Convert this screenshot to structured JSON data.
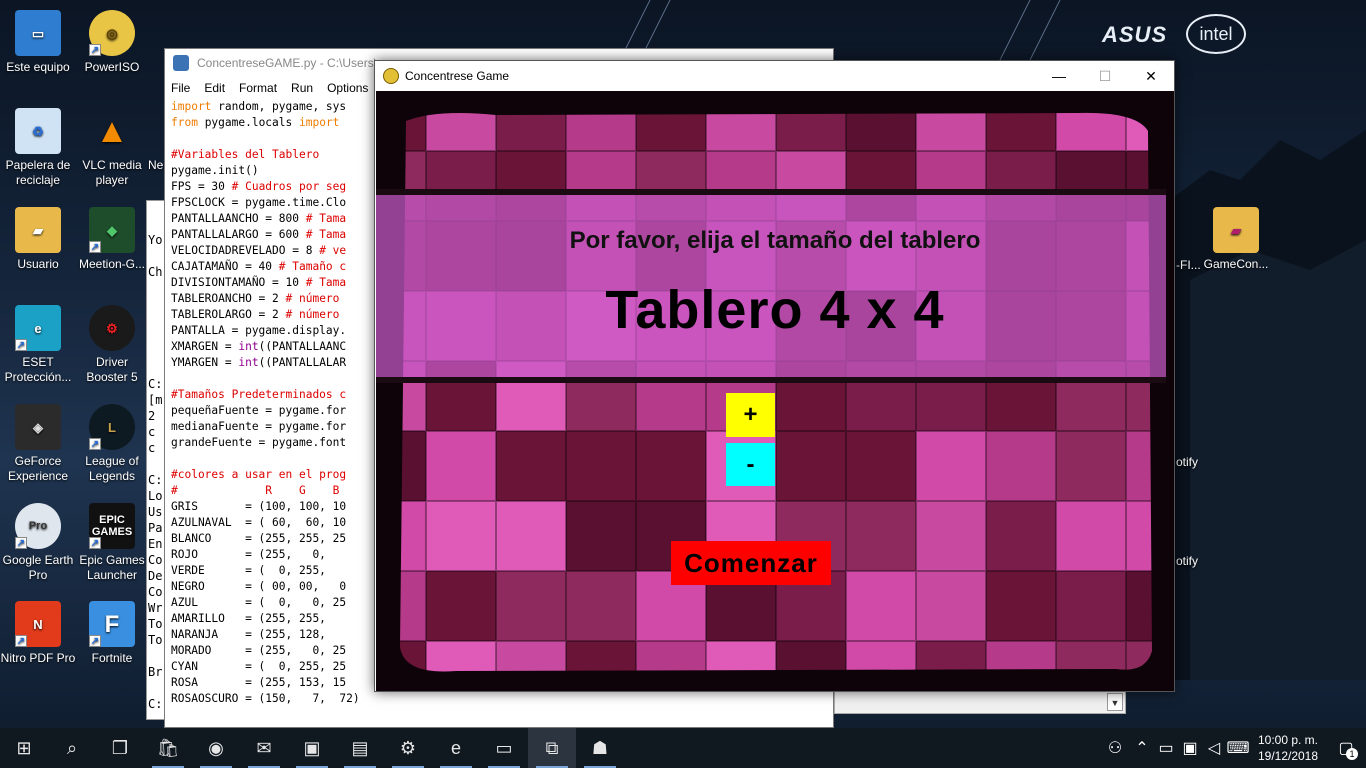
{
  "desktop": {
    "brand_asus": "ASUS",
    "brand_intel": "intel",
    "icons": [
      {
        "label": "Este equipo"
      },
      {
        "label": "PowerISO"
      },
      {
        "label": "Papelera de reciclaje"
      },
      {
        "label": "VLC media player"
      },
      {
        "label": "Usuario"
      },
      {
        "label": "Meetion-G..."
      },
      {
        "label": "ESET Protección..."
      },
      {
        "label": "Driver Booster 5"
      },
      {
        "label": "GeForce Experience"
      },
      {
        "label": "League of Legends"
      },
      {
        "label": "Google Earth Pro"
      },
      {
        "label": "Epic Games Launcher"
      },
      {
        "label": "Nitro PDF Pro"
      },
      {
        "label": "Fortnite"
      },
      {
        "label": "GameCon..."
      }
    ],
    "partial_labels": {
      "ne": "Ne",
      "fi": "-FI...",
      "otify1": "otify",
      "otify2": "otify"
    },
    "icon_badges": {
      "epic": "EPIC GAMES",
      "pro": "Pro"
    }
  },
  "idle": {
    "title": "ConcentreseGAME.py - C:\\Users\\...",
    "menu": [
      "File",
      "Edit",
      "Format",
      "Run",
      "Options"
    ],
    "code": [
      [
        {
          "t": "import",
          "c": "kw"
        },
        {
          "t": " random, pygame, sys"
        }
      ],
      [
        {
          "t": "from",
          "c": "kw"
        },
        {
          "t": " pygame.locals "
        },
        {
          "t": "import",
          "c": "kw"
        }
      ],
      [
        {
          "t": ""
        }
      ],
      [
        {
          "t": "#Variables del Tablero",
          "c": "cm"
        }
      ],
      [
        {
          "t": "pygame.init()"
        }
      ],
      [
        {
          "t": "FPS = 30 "
        },
        {
          "t": "# Cuadros por seg",
          "c": "cm"
        }
      ],
      [
        {
          "t": "FPSCLOCK = pygame.time.Clo"
        }
      ],
      [
        {
          "t": "PANTALLAANCHO = 800 "
        },
        {
          "t": "# Tama",
          "c": "cm"
        }
      ],
      [
        {
          "t": "PANTALLALARGO = 600 "
        },
        {
          "t": "# Tama",
          "c": "cm"
        }
      ],
      [
        {
          "t": "VELOCIDADREVELADO = 8 "
        },
        {
          "t": "# ve",
          "c": "cm"
        }
      ],
      [
        {
          "t": "CAJATAMAÑO = 40 "
        },
        {
          "t": "# Tamaño c",
          "c": "cm"
        }
      ],
      [
        {
          "t": "DIVISIONTAMAÑO = 10 "
        },
        {
          "t": "# Tama",
          "c": "cm"
        }
      ],
      [
        {
          "t": "TABLEROANCHO = 2 "
        },
        {
          "t": "# número",
          "c": "cm"
        }
      ],
      [
        {
          "t": "TABLEROLARGO = 2 "
        },
        {
          "t": "# número",
          "c": "cm"
        }
      ],
      [
        {
          "t": "PANTALLA = pygame.display."
        }
      ],
      [
        {
          "t": "XMARGEN = "
        },
        {
          "t": "int",
          "c": "bi"
        },
        {
          "t": "((PANTALLAANC"
        }
      ],
      [
        {
          "t": "YMARGEN = "
        },
        {
          "t": "int",
          "c": "bi"
        },
        {
          "t": "((PANTALLALAR"
        }
      ],
      [
        {
          "t": ""
        }
      ],
      [
        {
          "t": "#Tamaños Predeterminados c",
          "c": "cm"
        }
      ],
      [
        {
          "t": "pequeñaFuente = pygame.for"
        }
      ],
      [
        {
          "t": "medianaFuente = pygame.for"
        }
      ],
      [
        {
          "t": "grandeFuente = pygame.font"
        }
      ],
      [
        {
          "t": ""
        }
      ],
      [
        {
          "t": "#colores a usar en el prog",
          "c": "cm"
        }
      ],
      [
        {
          "t": "#             R    G    B",
          "c": "cm"
        }
      ],
      [
        {
          "t": "GRIS       = (100, 100, 10"
        }
      ],
      [
        {
          "t": "AZULNAVAL  = ( 60,  60, 10"
        }
      ],
      [
        {
          "t": "BLANCO     = (255, 255, 25"
        }
      ],
      [
        {
          "t": "ROJO       = (255,   0,"
        }
      ],
      [
        {
          "t": "VERDE      = (  0, 255,"
        }
      ],
      [
        {
          "t": "NEGRO      = ( 00, 00,   0"
        }
      ],
      [
        {
          "t": "AZUL       = (  0,   0, 25"
        }
      ],
      [
        {
          "t": "AMARILLO   = (255, 255,"
        }
      ],
      [
        {
          "t": "NARANJA    = (255, 128,"
        }
      ],
      [
        {
          "t": "MORADO     = (255,   0, 25"
        }
      ],
      [
        {
          "t": "CYAN       = (  0, 255, 25"
        }
      ],
      [
        {
          "t": "ROSA       = (255, 153, 15"
        }
      ],
      [
        {
          "t": "ROSAOSCURO = (150,   7,  72)"
        }
      ]
    ]
  },
  "console_fragments": [
    "Yo",
    "Ch",
    "C:",
    "[m",
    " 2",
    " c",
    " c",
    "C:",
    "Lo",
    "Us",
    "Pa",
    "En",
    "Co",
    "De",
    "Co",
    "Wr",
    "To",
    "To",
    "Br",
    "C:"
  ],
  "game": {
    "window_title": "Concentrese Game",
    "minimize": "—",
    "maximize": "☐",
    "close": "✕",
    "prompt": "Por favor, elija el tamaño del tablero",
    "board_label": "Tablero 4 x 4",
    "plus_label": "+",
    "minus_label": "-",
    "start_label": "Comenzar",
    "colors": {
      "plus_bg": "#ffff00",
      "minus_bg": "#00ffff",
      "start_bg": "#ff0000",
      "banner": "#c85ac8"
    }
  },
  "taskbar": {
    "apps": [
      {
        "name": "start-icon",
        "glyph": "⊞"
      },
      {
        "name": "search-icon",
        "glyph": "⌕"
      },
      {
        "name": "task-view-icon",
        "glyph": "❐"
      },
      {
        "name": "store-icon",
        "glyph": "🛍"
      },
      {
        "name": "chrome-icon",
        "glyph": "◉"
      },
      {
        "name": "mail-icon",
        "glyph": "✉"
      },
      {
        "name": "contacts-icon",
        "glyph": "▣"
      },
      {
        "name": "file-explorer-icon",
        "glyph": "▤"
      },
      {
        "name": "driver-booster-icon",
        "glyph": "⚙"
      },
      {
        "name": "edge-icon",
        "glyph": "e"
      },
      {
        "name": "cmd-icon",
        "glyph": "▭"
      },
      {
        "name": "python-icon",
        "glyph": "⧉"
      },
      {
        "name": "pygame-icon",
        "glyph": "☗"
      }
    ],
    "time": "10:00 p. m.",
    "date": "19/12/2018",
    "notification_count": "1"
  }
}
